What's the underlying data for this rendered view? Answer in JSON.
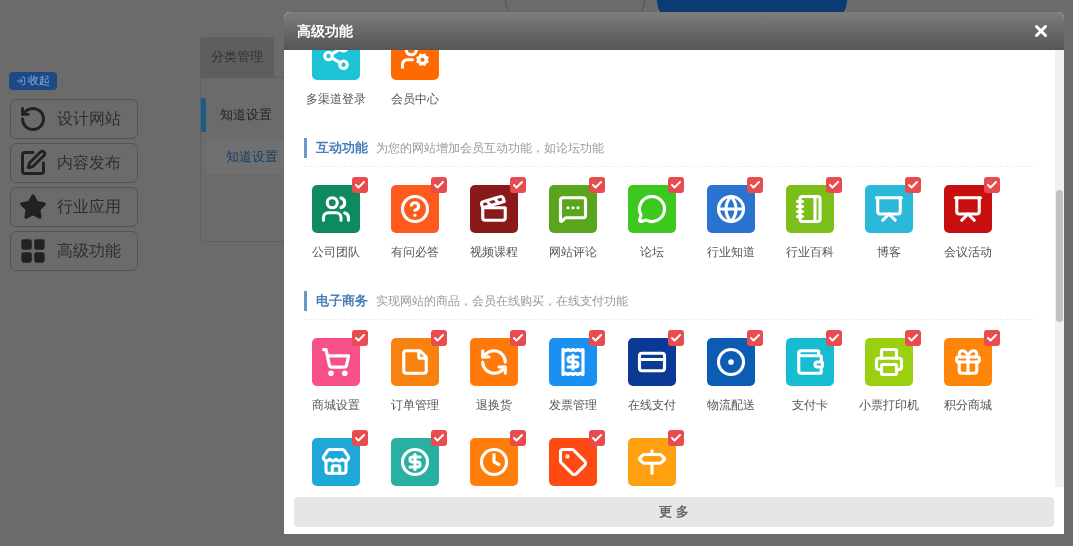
{
  "sidebar": {
    "collapse": "收起",
    "buttons": [
      {
        "label": "设计网站"
      },
      {
        "label": "内容发布"
      },
      {
        "label": "行业应用"
      },
      {
        "label": "高级功能"
      }
    ]
  },
  "panel": {
    "tabs": [
      {
        "label": "分类管理",
        "selected": true
      }
    ],
    "menu": [
      {
        "label": "知道设置",
        "selected": true
      }
    ],
    "link": "知道设置"
  },
  "modal": {
    "title": "高级功能",
    "more_button": "更 多",
    "sections": [
      {
        "items": [
          {
            "label": "多渠道登录",
            "color": "#1cc4d6"
          },
          {
            "label": "会员中心",
            "color": "#ff6a00"
          }
        ]
      },
      {
        "title": "互动功能",
        "description": "为您的网站增加会员互动功能，如论坛功能",
        "items": [
          {
            "label": "公司团队",
            "color": "#0e8a5f",
            "checked": true
          },
          {
            "label": "有问必答",
            "color": "#ff5a1e",
            "checked": true
          },
          {
            "label": "视频课程",
            "color": "#8a1a1a",
            "checked": true
          },
          {
            "label": "网站评论",
            "color": "#5aa51e",
            "checked": true
          },
          {
            "label": "论坛",
            "color": "#3cc81e",
            "checked": true
          },
          {
            "label": "行业知道",
            "color": "#2a73d0",
            "checked": true
          },
          {
            "label": "行业百科",
            "color": "#7cbf1a",
            "checked": true
          },
          {
            "label": "博客",
            "color": "#2cb8d8",
            "checked": true
          },
          {
            "label": "会议活动",
            "color": "#c80f0f",
            "checked": true
          }
        ]
      },
      {
        "title": "电子商务",
        "description": "实现网站的商品，会员在线购买，在线支付功能",
        "items": [
          {
            "label": "商城设置",
            "color": "#f7508a",
            "checked": true
          },
          {
            "label": "订单管理",
            "color": "#f7820f",
            "checked": true
          },
          {
            "label": "退换货",
            "color": "#ff7a0a",
            "checked": true
          },
          {
            "label": "发票管理",
            "color": "#1a90f0",
            "checked": true
          },
          {
            "label": "在线支付",
            "color": "#0a3a96",
            "checked": true
          },
          {
            "label": "物流配送",
            "color": "#0c5cb4",
            "checked": true
          },
          {
            "label": "支付卡",
            "color": "#18bcd0",
            "checked": true
          },
          {
            "label": "小票打印机",
            "color": "#9ad010",
            "checked": true
          },
          {
            "label": "积分商城",
            "color": "#ff840a",
            "checked": true
          },
          {
            "color": "#1ea8d8",
            "checked": true
          },
          {
            "color": "#28b0a0",
            "checked": true
          },
          {
            "color": "#ff7e0a",
            "checked": true
          },
          {
            "color": "#ff4a14",
            "checked": true
          },
          {
            "color": "#ffa010",
            "checked": true
          }
        ]
      }
    ]
  }
}
